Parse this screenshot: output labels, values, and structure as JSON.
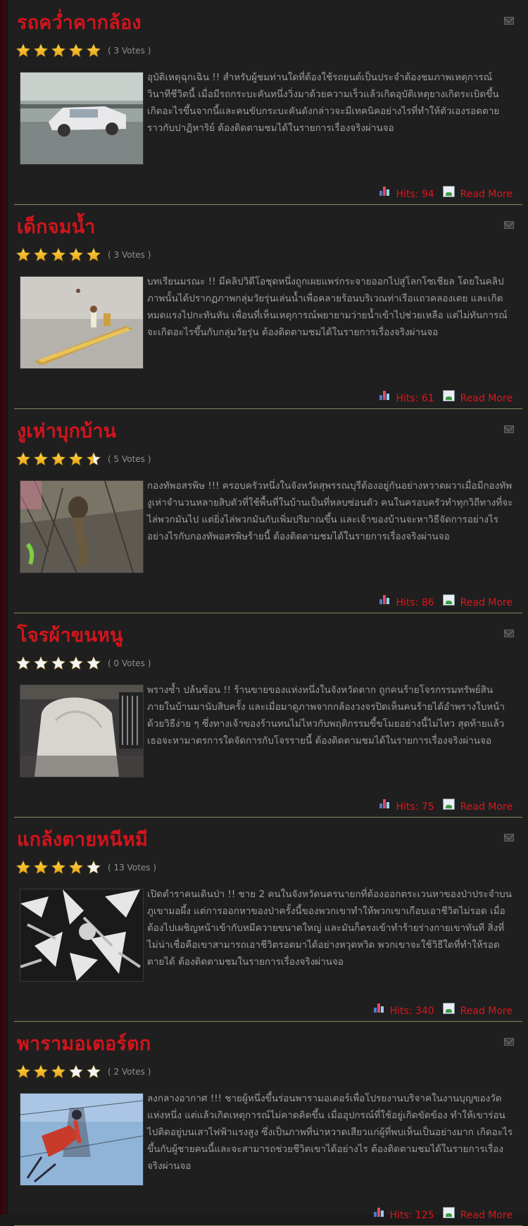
{
  "articles": [
    {
      "title": "รถคว่ำคากล้อง",
      "rating": 5,
      "votes_label": "( 3 Votes )",
      "description": "อุบัติเหตุฉุกเฉิน !! สำหรับผู้ชมท่านใดที่ต้องใช้รถยนต์เป็นประจำต้องชมภาพเหตุการณ์วินาทีชีวิตนี้ เมื่อมีรถกระบะคันหนึ่งวิ่งมาด้วยความเร็วแล้วเกิดอุบัติเหตุยางเกิดระเบิดขึ้น เกิดอะไรขึ้นจากนี้และคนขับกระบะคันดังกล่าวจะมีเทคนิคอย่างไรที่ทำให้ตัวเองรอดตายราวกับปาฏิหาริย์ ต้องติดตามชมได้ในรายการเรื่องจริงผ่านจอ",
      "hits_label": "Hits: 94",
      "read_more": "Read More",
      "thumb": "car-crash"
    },
    {
      "title": "เด็กจมน้ำ",
      "rating": 5,
      "votes_label": "( 3 Votes )",
      "description": "บทเรียนมรณะ !! มีคลิปวิดีโอชุดหนึ่งถูกเผยแพร่กระจายออกไปสู่โลกโซเชียล โดยในคลิปภาพนั้นได้ปรากฏภาพกลุ่มวัยรุ่นเล่นน้ำเพื่อคลายร้อนบริเวณท่าเรือแถวคลองเตย และเกิดหมดแรงไปกะทันหัน เพื่อนที่เห็นเหตุการณ์พยายามว่ายน้ำเข้าไปช่วยเหลือ แต่ไม่ทันการณ์จะเกิดอะไรขึ้นกับกลุ่มวัยรุ่น ต้องติดตามชมได้ในรายการเรื่องจริงผ่านจอ",
      "hits_label": "Hits: 61",
      "read_more": "Read More",
      "thumb": "boat"
    },
    {
      "title": "งูเห่าบุกบ้าน",
      "rating": 4.5,
      "votes_label": "( 5 Votes )",
      "description": "กองทัพอสรพิษ !!! ครอบครัวหนึ่งในจังหวัดสุพรรณบุรีต้องอยู่กันอย่างหวาดผวาเมื่อมีกองทัพงูเห่าจำนวนหลายสิบตัวที่ใช้พื้นที่ในบ้านเป็นที่หลบซ่อนตัว คนในครอบครัวทำทุกวิถีทางที่จะไล่พวกมันไป แต่ยิ่งไล่พวกมันกับเพิ่มปริมาณขึ้น และเจ้าของบ้านจะหาวิธีจัดการอย่างไรอย่างไรกับกองทัพอสรพิษร้ายนี้ ต้องติดตามชมได้ในรายการเรื่องจริงผ่านจอ",
      "hits_label": "Hits: 86",
      "read_more": "Read More",
      "thumb": "cobra"
    },
    {
      "title": "โจรผ้าขนหนู",
      "rating": 0,
      "votes_label": "( 0 Votes )",
      "description": "พรางซ้ำ ปล้นซ้อน !! ร้านขายของแห่งหนึ่งในจังหวัดตาก ถูกคนร้ายโจรกรรมทรัพย์สินภายในบ้านมานับสิบครั้ง และเมื่อมาดูภาพจากกล้องวงจรปิดเห็นคนร้ายได้อำพรางใบหน้าด้วยวิธีง่าย ๆ ซึ่งทางเจ้าของร้านทนไม่ไหวกับพฤติกรรมขี้ขโมยอย่างนี้ไม่ไหว สุดท้ายแล้วเธอจะหามาตรการใดจัดการกับโจรรายนี้ ต้องติดตามชมได้ในรายการเรื่องจริงผ่านจอ",
      "hits_label": "Hits: 75",
      "read_more": "Read More",
      "thumb": "towel-thief"
    },
    {
      "title": "แกล้งตายหนีหมี",
      "rating": 4,
      "votes_label": "( 13 Votes )",
      "description": "เปิดตำราคนเดินป่า !! ชาย 2 คนในจังหวัดนครนายกที่ต้องออกตระเวนหาของป่าประจำบนภูเขามอผึ้ง แต่การออกหาของป่าครั้งนี้ของพวกเขาทำให้พวกเขาเกือบเอาชีวิตไม่รอด เมื่อต้องไปเผชิญหน้าเข้ากับหมีควายขนาดใหญ่ และมันก็ตรงเข้าทำร้ายร่างกายเขาทันที สิ่งที่ไม่น่าเชื่อคือเขาสามารถเอาชีวิตรอดมาได้อย่างหวุดหวิด พวกเขาจะใช้วิธีใดที่ทำให้รอดตายได้ ต้องติดตามชมในรายการเรื่องจริงผ่านจอ",
      "hits_label": "Hits: 340",
      "read_more": "Read More",
      "thumb": "bear"
    },
    {
      "title": "พารามอเตอร์ตก",
      "rating": 3,
      "votes_label": "( 2 Votes )",
      "description": "ลงกลางอากาศ !!! ชายผู้หนึ่งขึ้นร่อนพารามอเตอร์เพื่อโปรยงานบริจาคในงานบุญของวัดแห่งหนึ่ง แต่แล้วเกิดเหตุการณ์ไม่คาดคิดขึ้น เมื่ออุปกรณ์ที่ใช้อยู่เกิดขัดข้อง ทำให้เขาร่อนไปติดอยู่บนเสาไฟฟ้าแรงสูง ซึ่งเป็นภาพที่น่าหวาดเสียวแก่ผู้ที่พบเห็นเป็นอย่างมาก เกิดอะไรขึ้นกับผู้ชายคนนี้และจะสามารถช่วยชีวิตเขาได้อย่างไร ต้องติดตามชมได้ในรายการเรื่องจริงผ่านจอ",
      "hits_label": "Hits: 125",
      "read_more": "Read More",
      "thumb": "paramotor"
    }
  ]
}
